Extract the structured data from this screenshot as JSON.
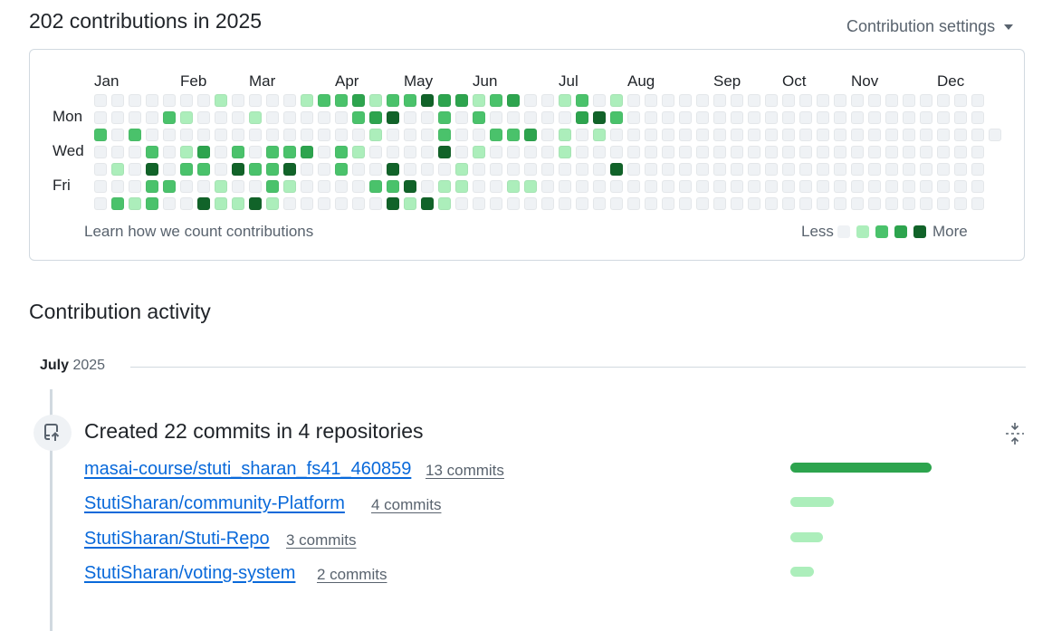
{
  "header": {
    "title": "202 contributions in 2025",
    "settings_label": "Contribution settings"
  },
  "calendar": {
    "months": [
      "Jan",
      "Feb",
      "Mar",
      "Apr",
      "May",
      "Jun",
      "Jul",
      "Aug",
      "Sep",
      "Oct",
      "Nov",
      "Dec"
    ],
    "day_labels": [
      "Mon",
      "Wed",
      "Fri"
    ],
    "levels": [
      "0000000100001223122433123001201000000000000000000000",
      "0000210001000002340020200000342000000000000000000000",
      "20200000000000001000200223010100000000000000000000000",
      "0002013020223021000040100001000000000000000000000000",
      "0104022042240020040001000000004000000000000000000000",
      "0002200100210000224011001100000000000000000000000000",
      "0212004114100000041410000000000000000000000000000000"
    ],
    "level_colors": [
      "#eff2f5",
      "#aceebb",
      "#4ac26b",
      "#2da44e",
      "#116329"
    ],
    "learn_link": "Learn how we count contributions",
    "legend_less": "Less",
    "legend_more": "More"
  },
  "activity": {
    "section_title": "Contribution activity",
    "month_label": "July",
    "year_label": "2025",
    "summary": "Created 22 commits in 4 repositories",
    "repos": [
      {
        "name": "masai-course/stuti_sharan_fs41_460859",
        "commits": "13 commits",
        "count": 13
      },
      {
        "name": "StutiSharan/community-Platform",
        "commits": "4 commits",
        "count": 4
      },
      {
        "name": "StutiSharan/Stuti-Repo",
        "commits": "3 commits",
        "count": 3
      },
      {
        "name": "StutiSharan/voting-system",
        "commits": "2 commits",
        "count": 2
      }
    ]
  }
}
